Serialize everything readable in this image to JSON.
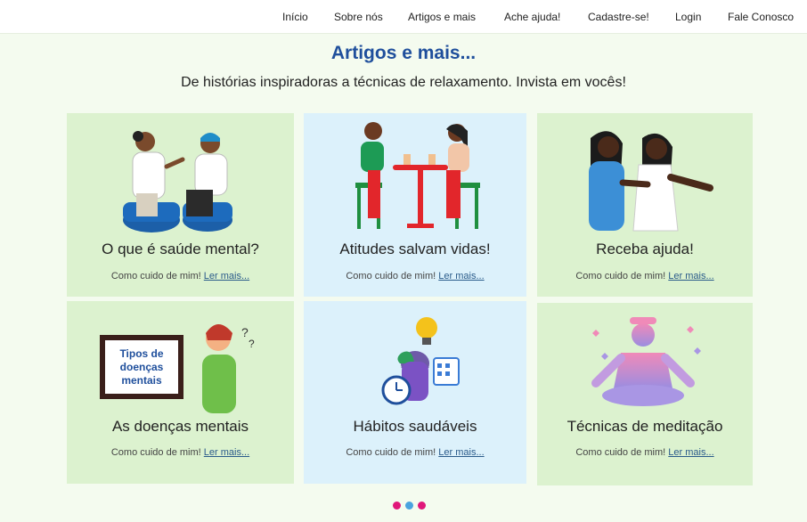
{
  "nav": {
    "items": [
      {
        "label": "Início"
      },
      {
        "label": "Sobre nós"
      },
      {
        "label": "Artigos e mais"
      },
      {
        "label": "Ache ajuda!"
      },
      {
        "label": "Cadastre-se!"
      },
      {
        "label": "Login"
      },
      {
        "label": "Fale Conosco"
      }
    ]
  },
  "page": {
    "title": "Artigos e mais...",
    "subtitle": "De histórias inspiradoras a técnicas de relaxamento. Invista em vocês!"
  },
  "cards": [
    {
      "title": "O que é saúde mental?",
      "meta": "Como cuido de mim!",
      "link": "Ler mais..."
    },
    {
      "title": "Atitudes salvam vidas!",
      "meta": "Como cuido de mim!",
      "link": "Ler mais..."
    },
    {
      "title": "Receba ajuda!",
      "meta": "Como cuido de mim!",
      "link": "Ler mais..."
    },
    {
      "title": "As doenças mentais",
      "meta": "Como cuido de mim!",
      "link": "Ler mais...",
      "illus_text": "Tipos de doenças mentais"
    },
    {
      "title": "Hábitos saudáveis",
      "meta": "Como cuido de mim!",
      "link": "Ler mais..."
    },
    {
      "title": "Técnicas de meditação",
      "meta": "Como cuido de mim!",
      "link": "Ler mais..."
    }
  ],
  "carousel": {
    "dot_colors": [
      "#e0177a",
      "#4aa3df",
      "#e0177a"
    ]
  },
  "colors": {
    "title_blue": "#1f4f9c",
    "card_green": "#dcf2cf",
    "card_blue": "#dcf1fb",
    "page_bg": "#f4fbef"
  }
}
